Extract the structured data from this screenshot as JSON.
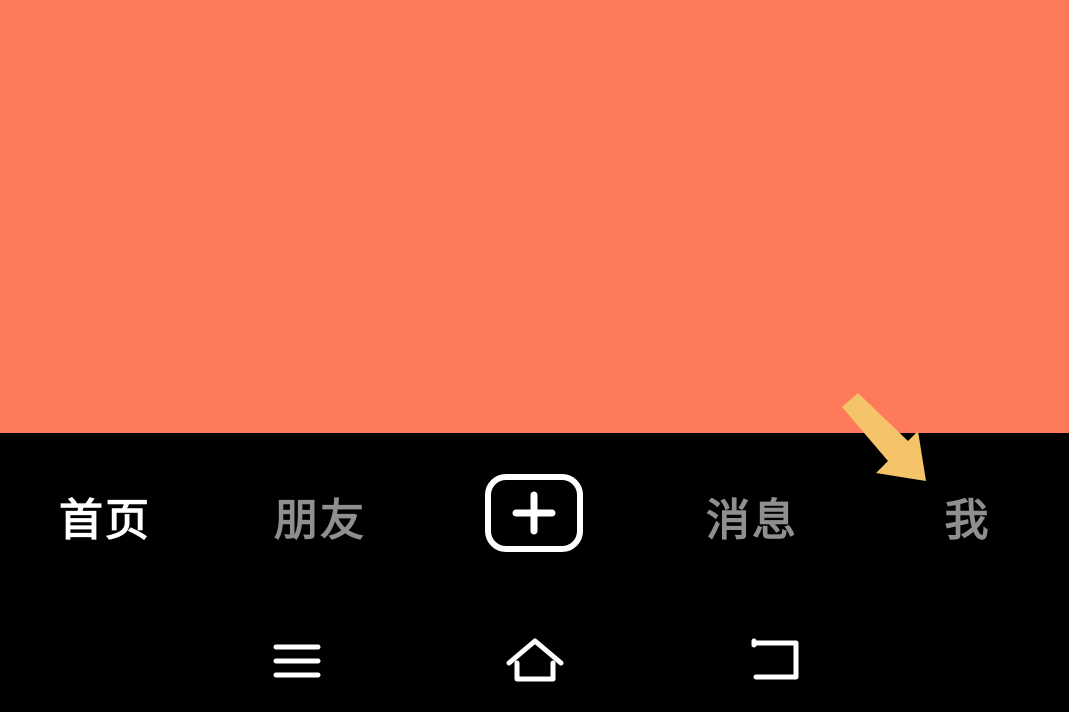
{
  "colors": {
    "content_background": "#FF7A5A",
    "tabbar_background": "#000000",
    "active_tab_text": "#FFFFFF",
    "inactive_tab_text": "#8F8F8F",
    "hint_arrow": "#F5C46A"
  },
  "tabbar": {
    "home_label": "首页",
    "friends_label": "朋友",
    "create_icon": "plus-square-icon",
    "messages_label": "消息",
    "me_label": "我",
    "active_tab": "首页"
  },
  "navbar": {
    "menu_icon": "menu-icon",
    "home_icon": "home-icon",
    "back_icon": "back-icon"
  },
  "annotation": {
    "arrow_icon": "pointer-arrow-icon"
  }
}
